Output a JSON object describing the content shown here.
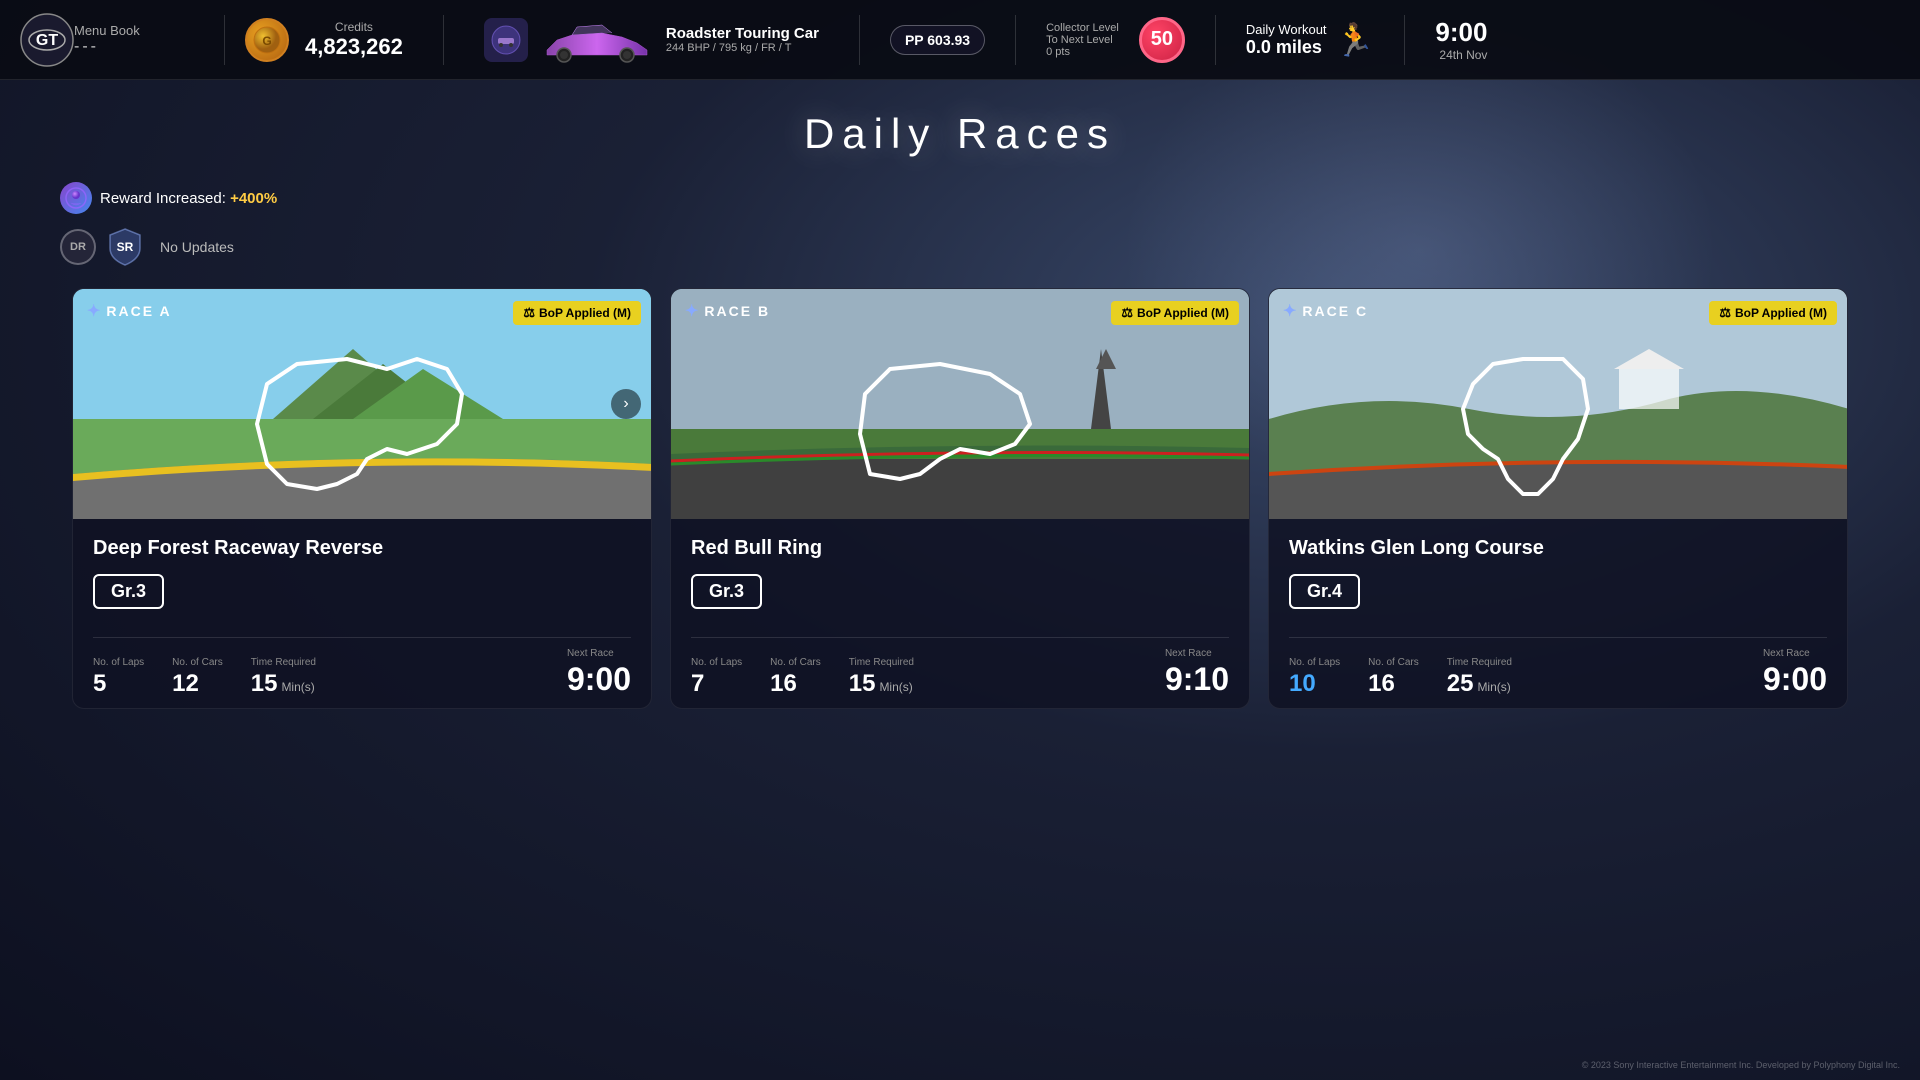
{
  "app": {
    "title": "Gran Turismo"
  },
  "topbar": {
    "logo_alt": "GT Logo",
    "menu_book_label": "Menu Book",
    "menu_book_dots": "---",
    "credits_label": "Credits",
    "credits_amount": "4,823,262",
    "car_name": "Roadster Touring Car",
    "car_stats": "244 BHP / 795 kg / FR / T",
    "pp_value": "PP 603.93",
    "collector_label": "Collector Level",
    "collector_next": "To Next Level",
    "collector_pts": "0 pts",
    "collector_level": "50",
    "daily_workout_label": "Daily Workout",
    "daily_workout_miles": "0.0 miles",
    "time": "9:00",
    "date": "24th Nov"
  },
  "main": {
    "title": "Daily  Races",
    "reward_text": "Reward Increased:",
    "reward_percent": "+400%",
    "no_updates": "No Updates",
    "dr_label": "DR",
    "sr_label": "SR"
  },
  "races": [
    {
      "id": "race_a",
      "race_label": "RACE A",
      "bop_label": "BoP Applied (M)",
      "track_name": "Deep Forest Raceway Reverse",
      "gr_class": "Gr.3",
      "laps_label": "No. of Laps",
      "laps": "5",
      "cars_label": "No. of Cars",
      "cars": "12",
      "time_req_label": "Time Required",
      "time_req": "15",
      "time_unit": "Min(s)",
      "next_race_label": "Next Race",
      "next_race": "9:00",
      "highlight_laps": false
    },
    {
      "id": "race_b",
      "race_label": "RACE B",
      "bop_label": "BoP Applied (M)",
      "track_name": "Red Bull Ring",
      "gr_class": "Gr.3",
      "laps_label": "No. of Laps",
      "laps": "7",
      "cars_label": "No. of Cars",
      "cars": "16",
      "time_req_label": "Time Required",
      "time_req": "15",
      "time_unit": "Min(s)",
      "next_race_label": "Next Race",
      "next_race": "9:10",
      "highlight_laps": false
    },
    {
      "id": "race_c",
      "race_label": "RACE C",
      "bop_label": "BoP Applied (M)",
      "track_name": "Watkins Glen Long Course",
      "gr_class": "Gr.4",
      "laps_label": "No. of Laps",
      "laps": "10",
      "cars_label": "No. of Cars",
      "cars": "16",
      "time_req_label": "Time Required",
      "time_req": "25",
      "time_unit": "Min(s)",
      "next_race_label": "Next Race",
      "next_race": "9:00",
      "highlight_laps": true
    }
  ],
  "copyright": "© 2023 Sony Interactive Entertainment Inc. Developed by Polyphony Digital Inc."
}
